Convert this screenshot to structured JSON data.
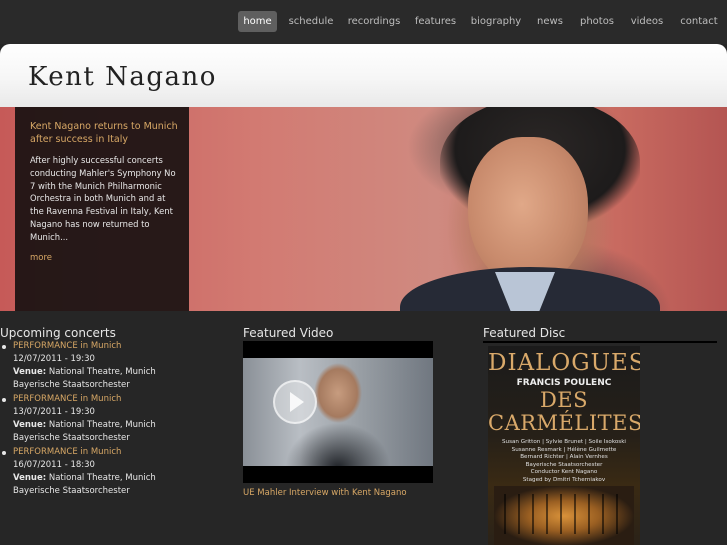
{
  "nav": {
    "items": [
      {
        "label": "home",
        "active": true
      },
      {
        "label": "schedule"
      },
      {
        "label": "recordings"
      },
      {
        "label": "features"
      },
      {
        "label": "biography"
      },
      {
        "label": "news"
      },
      {
        "label": "photos"
      },
      {
        "label": "videos"
      },
      {
        "label": "contact"
      }
    ]
  },
  "header": {
    "logo": "Kent Nagano"
  },
  "hero": {
    "title": "Kent Nagano returns to Munich after success in Italy",
    "text": "After highly successful concerts conducting Mahler's Symphony No 7 with the Munich Philharmonic Orchestra in both Munich and at the Ravenna Festival in Italy, Kent Nagano has now returned to Munich...",
    "more": "more"
  },
  "concerts": {
    "heading": "Upcoming concerts",
    "venue_label": "Venue:",
    "items": [
      {
        "link": "PERFORMANCE in Munich",
        "datetime": "12/07/2011 - 19:30",
        "venue": "National Theatre, Munich",
        "orchestra": "Bayerische Staatsorchester"
      },
      {
        "link": "PERFORMANCE in Munich",
        "datetime": "13/07/2011 - 19:30",
        "venue": "National Theatre, Munich",
        "orchestra": "Bayerische Staatsorchester"
      },
      {
        "link": "PERFORMANCE in Munich",
        "datetime": "16/07/2011 - 18:30",
        "venue": "National Theatre, Munich",
        "orchestra": "Bayerische Staatsorchester"
      }
    ]
  },
  "video": {
    "heading": "Featured Video",
    "caption": "UE Mahler Interview with Kent Nagano"
  },
  "disc": {
    "heading": "Featured Disc",
    "title_line1": "DIALOGUES",
    "composer": "FRANCIS POULENC",
    "title_line2": "DES\nCARMÉLITES",
    "credits": "Susan Gritton | Sylvie Brunet | Soile Isokoski\nSusanne Resmark | Hélène Guilmette\nBernard Richter | Alain Vernhes\nBayerische Staatsorchester\nConductor Kent Nagano\nStaged by Dmitri Tcherniakov"
  },
  "colors": {
    "accent": "#d8a866",
    "background": "#262626",
    "nav_active": "#5f5f5f"
  }
}
